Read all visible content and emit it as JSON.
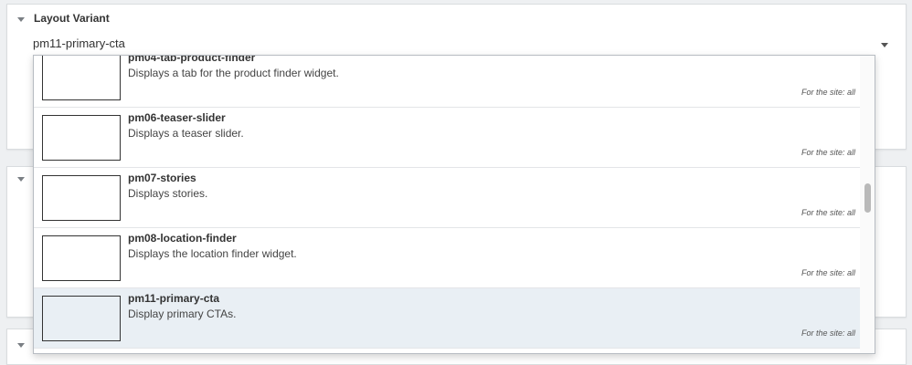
{
  "layout_variant": {
    "title": "Layout Variant",
    "value": "pm11-primary-cta",
    "options": [
      {
        "name": "pm04-tab-product-finder",
        "description": "Displays a tab for the product finder widget.",
        "site": "For the site: all",
        "selected": false
      },
      {
        "name": "pm06-teaser-slider",
        "description": "Displays a teaser slider.",
        "site": "For the site: all",
        "selected": false
      },
      {
        "name": "pm07-stories",
        "description": "Displays stories.",
        "site": "For the site: all",
        "selected": false
      },
      {
        "name": "pm08-location-finder",
        "description": "Displays the location finder widget.",
        "site": "For the site: all",
        "selected": false
      },
      {
        "name": "pm11-primary-cta",
        "description": "Display primary CTAs.",
        "site": "For the site: all",
        "selected": true
      }
    ]
  },
  "icons": {
    "collapse": "caret-down-icon",
    "dropdown": "caret-down-icon"
  },
  "colors": {
    "selected_option_bg": "#e9eff4",
    "panel_bg": "#ffffff",
    "page_bg": "#eef0f2"
  }
}
